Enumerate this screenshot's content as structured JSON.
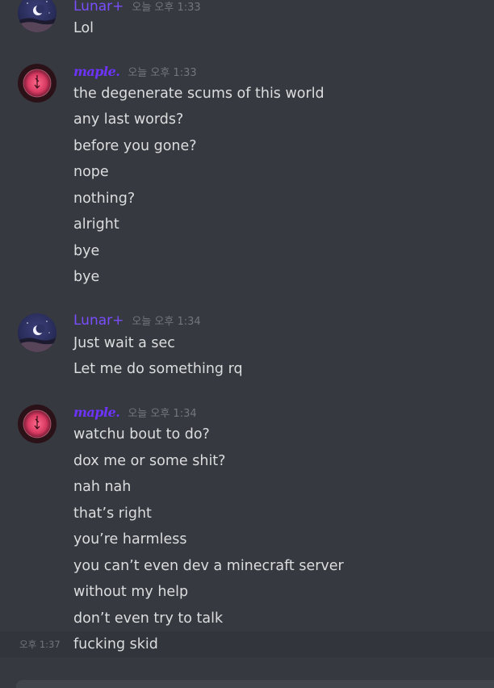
{
  "messages": [
    {
      "author": "Lunar+",
      "time": "오늘 오후 1:33",
      "lines": [
        "Lol"
      ]
    },
    {
      "author": "maple.",
      "time": "오늘 오후 1:33",
      "lines": [
        "the degenerate scums of this world",
        "any last words?",
        "before you gone?",
        "nope",
        "nothing?",
        "alright",
        "bye",
        "bye"
      ]
    },
    {
      "author": "Lunar+",
      "time": "오늘 오후 1:34",
      "lines": [
        "Just wait a sec",
        "Let me do something rq"
      ]
    },
    {
      "author": "maple.",
      "time": "오늘 오후 1:34",
      "lines": [
        "watchu bout to do?",
        "dox me or some shit?",
        "nah nah",
        "that’s right",
        "you’re harmless",
        "you can’t even dev a minecraft server",
        "without my help",
        "don’t even try to talk",
        "fucking skid"
      ],
      "hover_time": "오후 1:37"
    }
  ],
  "colors": {
    "background": "#36393f",
    "hover_row": "#32353b",
    "text": "#dcddde",
    "timestamp": "#72767d",
    "lunar_name": "#7a4dff",
    "maple_name": "#6e33ff"
  }
}
